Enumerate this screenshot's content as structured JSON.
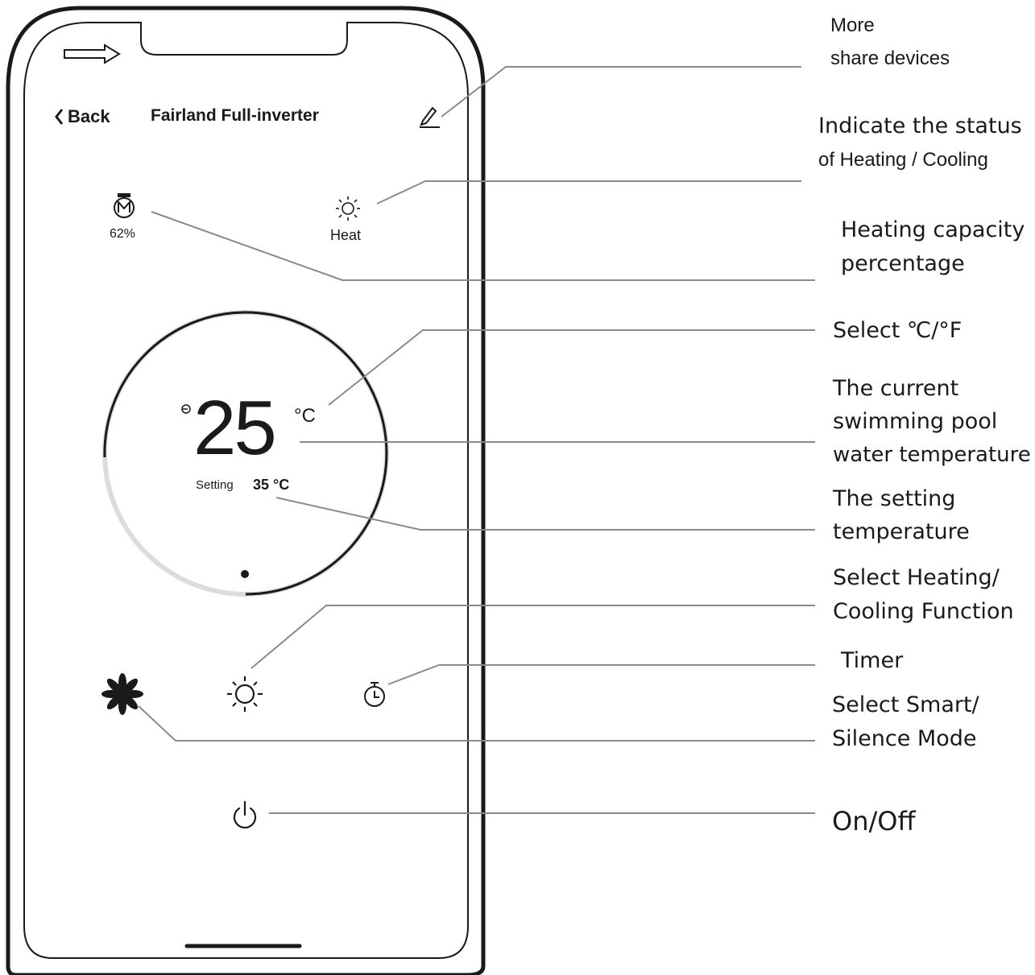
{
  "phone": {
    "back_label": "Back",
    "device_title": "Fairland Full-inverter",
    "capacity_value": "62%",
    "mode_status": "Heat",
    "current_temp": "25",
    "temp_unit": "°C",
    "setting_label": "Setting",
    "setting_value": "35 °C"
  },
  "icons": {
    "edit": "pencil-icon",
    "compressor": "compressor-icon",
    "status": "sun-icon",
    "water": "water-inlet-icon",
    "fan": "fan-icon",
    "heat_cool": "sun-icon",
    "timer": "timer-icon",
    "power": "power-icon",
    "arrow": "right-arrow-icon"
  },
  "annotations": {
    "more": "More",
    "share": "share devices",
    "status_1": "Indicate the status",
    "status_2": "of Heating / Cooling",
    "capacity_1": "Heating capacity",
    "capacity_2": "percentage",
    "unit_select": "Select ℃/°F",
    "current_1": "The current",
    "current_2": "swimming pool",
    "current_3": "water temperature",
    "setting_1": "The setting",
    "setting_2": "temperature",
    "function_1": "Select Heating/",
    "function_2": "Cooling Function",
    "timer": "Timer",
    "mode_1": "Select Smart/",
    "mode_2": "Silence Mode",
    "onoff": "On/Off"
  }
}
